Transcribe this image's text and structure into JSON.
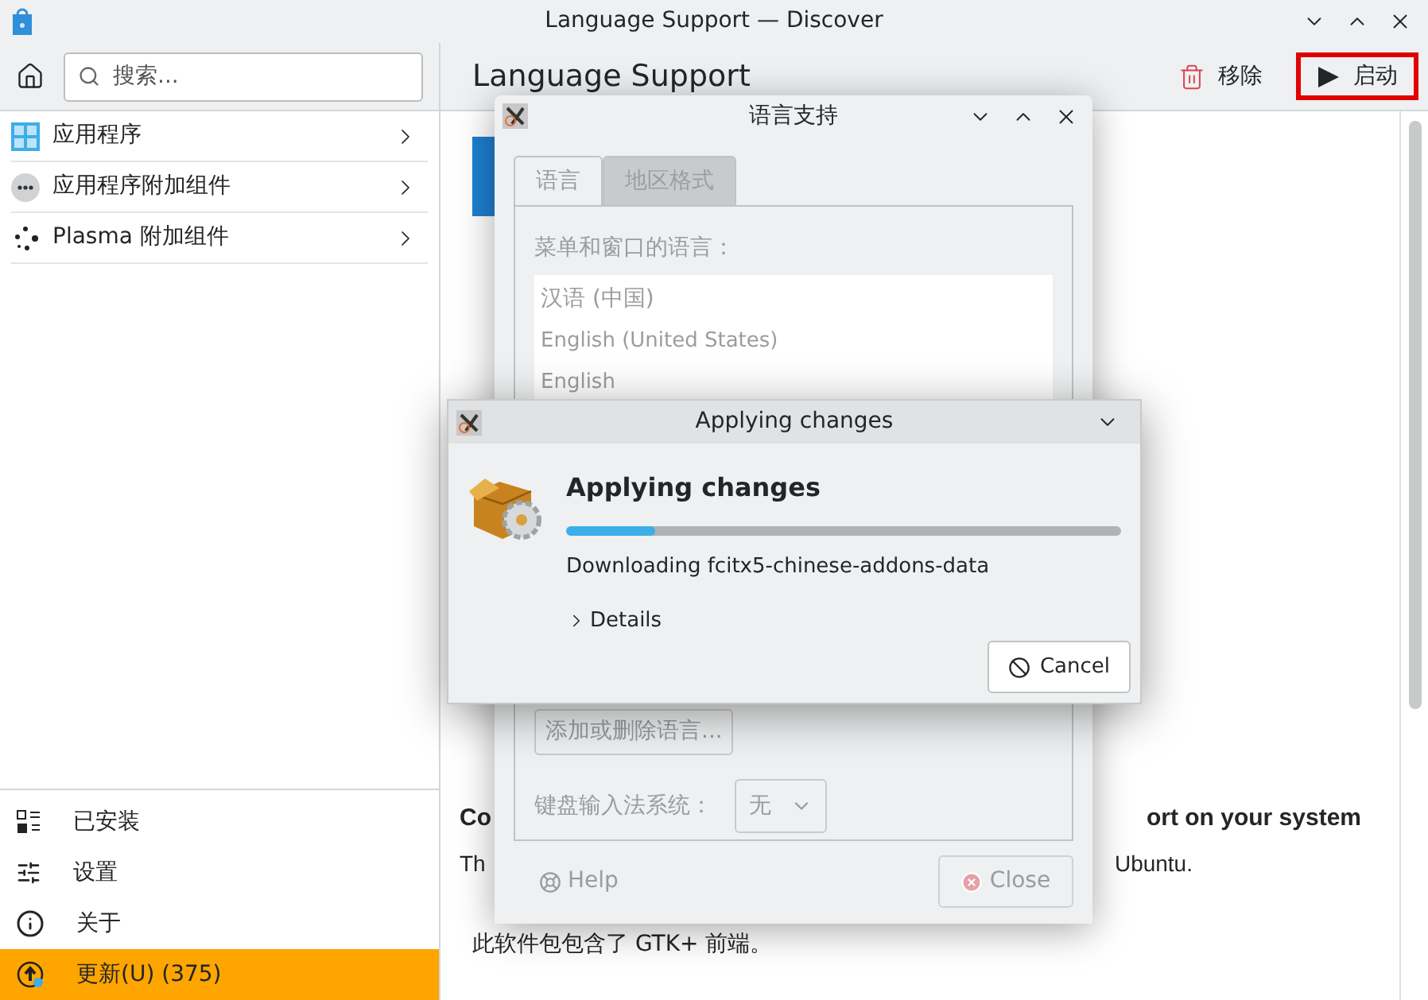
{
  "window": {
    "title": "Language Support — Discover"
  },
  "search": {
    "placeholder": "搜索..."
  },
  "categories": [
    {
      "label": "应用程序",
      "kind": "apps"
    },
    {
      "label": "应用程序附加组件",
      "kind": "addons"
    },
    {
      "label": "Plasma 附加组件",
      "kind": "plasma"
    }
  ],
  "nav": [
    {
      "label": "已安装",
      "kind": "installed",
      "selected": false
    },
    {
      "label": "设置",
      "kind": "settings",
      "selected": false
    },
    {
      "label": "关于",
      "kind": "about",
      "selected": false
    },
    {
      "label": "更新(U) (375)",
      "kind": "updates",
      "selected": true
    }
  ],
  "page": {
    "title": "Language Support",
    "actions": [
      {
        "label": "移除",
        "kind": "remove",
        "highlighted": false
      },
      {
        "label": "启动",
        "kind": "launch",
        "highlighted": true
      }
    ],
    "heading_start": "Co",
    "heading_end": "ort on your system",
    "text_start": "Th",
    "text_end": "Ubuntu.",
    "note": "此软件包包含了 GTK+ 前端。"
  },
  "language_dialog": {
    "title": "语言支持",
    "tabs": [
      {
        "label": "语言",
        "selected": true
      },
      {
        "label": "地区格式",
        "selected": false
      }
    ],
    "languages_label": "菜单和窗口的语言：",
    "languages": [
      "汉语 (中国)",
      "English (United States)",
      "English"
    ],
    "add_button": "添加或删除语言...",
    "input_label": "键盘输入法系统：",
    "input_value": "无",
    "help_button": "Help",
    "close_button": "Close"
  },
  "progress_dialog": {
    "title": "Applying changes",
    "heading": "Applying changes",
    "level": 0.16,
    "status": "Downloading fcitx5-chinese-addons-data",
    "details": "Details",
    "cancel_button": "Cancel"
  }
}
